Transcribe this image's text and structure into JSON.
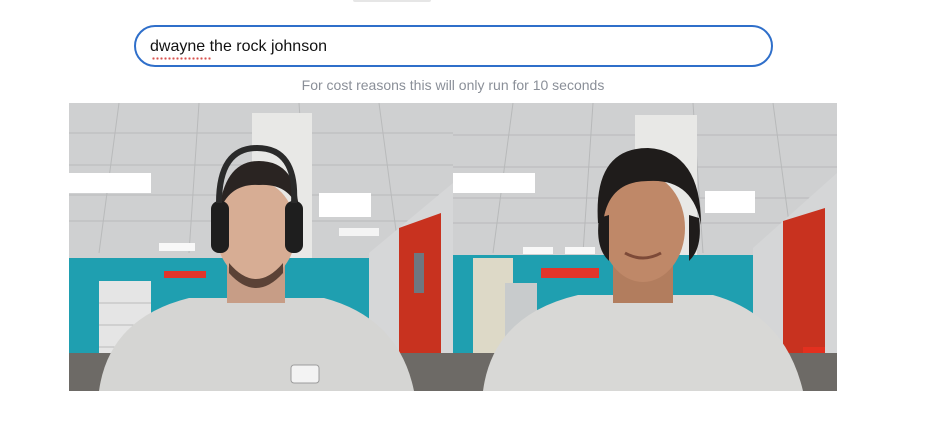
{
  "prompt": {
    "value": "dwayne the rock johnson",
    "placeholder": ""
  },
  "note": "For cost reasons this will only run for 10 seconds",
  "frames": {
    "input_label": "",
    "output_label": ""
  },
  "colors": {
    "input_border": "#2f6fca",
    "note_text": "#8a8f98",
    "ceiling": "#d9dadb",
    "wall_teal": "#1f9fb0",
    "door_red": "#c8321f",
    "shirt": "#d5d5d3"
  },
  "icons": [
    "camera-input-frame",
    "ai-output-frame"
  ]
}
